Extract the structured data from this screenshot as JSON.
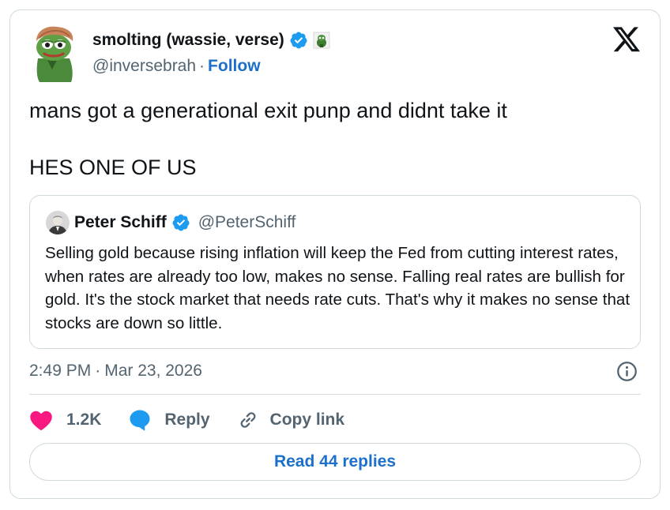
{
  "author": {
    "name": "smolting (wassie, verse)",
    "handle": "@inversebrah",
    "separator": "·",
    "follow_label": "Follow"
  },
  "tweet": {
    "lines": [
      "mans got a generational exit punp and didnt take it",
      "HES ONE OF US"
    ]
  },
  "quoted": {
    "name": "Peter Schiff",
    "handle": "@PeterSchiff",
    "text": "Selling gold because rising inflation will keep the Fed from cutting interest rates, when rates are already too low, makes no sense. Falling real rates are bullish for gold. It's the stock market that needs rate cuts. That's why it makes no sense that stocks are down so little."
  },
  "meta": {
    "time": "2:49 PM",
    "separator": "·",
    "date": "Mar 23, 2026"
  },
  "actions": {
    "like_count": "1.2K",
    "reply_label": "Reply",
    "copy_label": "Copy link"
  },
  "read_replies_label": "Read 44 replies",
  "colors": {
    "verified": "#1d9bf0",
    "like": "#f91880",
    "reply": "#1d9bf0",
    "link": "#1d70c9",
    "border": "#cfd9de",
    "secondary_text": "#536471"
  },
  "icons": {
    "verified": "verified-badge-icon",
    "x_logo": "x-logo-icon",
    "info": "info-icon",
    "like": "heart-icon",
    "reply": "speech-bubble-icon",
    "copy": "link-icon"
  }
}
